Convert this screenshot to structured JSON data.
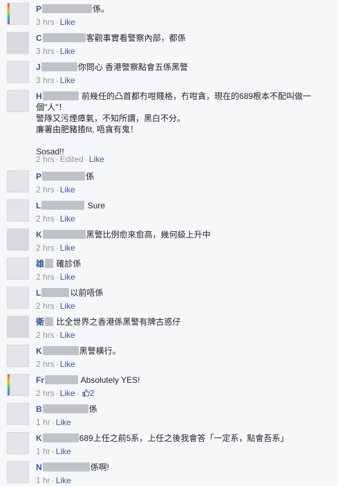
{
  "like_label": "Like",
  "edited_label": "Edited",
  "comments": [
    {
      "name_initial": "P",
      "text": "係。",
      "time": "3 hrs"
    },
    {
      "name_initial": "C",
      "text": "客觀事實看警察內部，都係",
      "time": "3 hrs"
    },
    {
      "name_initial": "J",
      "text": "你問心 香港警察點會五係黑警",
      "time": "3 hrs"
    },
    {
      "name_initial": "H",
      "lines": [
        "前幾任的凸首都冇咁賤格，冇咁貪，現在的689根本不配叫做一",
        "個\"人\"！",
        "警隊又污煙瘴氣，不知所謂，黑白不分。",
        "廉署由肥豬揸fit, 唔貪有鬼！",
        "",
        "Sosad!!"
      ],
      "time": "2 hrs"
    },
    {
      "name_initial": "P",
      "text": "係",
      "time": "2 hrs"
    },
    {
      "name_initial": "L",
      "text": "Sure",
      "time": "2 hrs"
    },
    {
      "name_initial": "K",
      "text": "黑警比例愈來愈高，幾何級上升中",
      "time": "2 hrs"
    },
    {
      "name_initial": "雄",
      "text": "確診係",
      "time": "2 hrs"
    },
    {
      "name_initial": "L",
      "text": "以前唔係",
      "time": "2 hrs"
    },
    {
      "name_initial": "衛",
      "text": "比全世界之香港係黑警有牌古惑仔",
      "time": "2 hrs"
    },
    {
      "name_initial": "K",
      "text": "黑警橫行。",
      "time": "2 hrs"
    },
    {
      "name_initial": "Fr",
      "text": "Absolutely YES!",
      "time": "2 hrs",
      "like_count": "2"
    },
    {
      "name_initial": "B",
      "text": "係",
      "time": "1 hr"
    },
    {
      "name_initial": "K",
      "text": "689上任之前5系，上任之後我會答「一定系，點會吾系」",
      "time": "1 hr"
    },
    {
      "name_initial": "N",
      "text": "係啊!",
      "time": "1 hr"
    }
  ]
}
